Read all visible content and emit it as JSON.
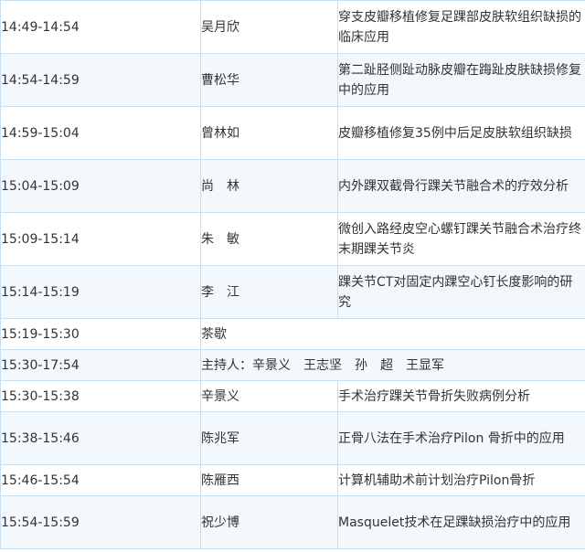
{
  "rows": [
    {
      "time": "14:49-14:54",
      "speaker": "吴月欣",
      "topic": "穿支皮瓣移植修复足踝部皮肤软组织缺损的临床应用"
    },
    {
      "time": "14:54-14:59",
      "speaker": "曹松华",
      "topic": "第二趾胫侧趾动脉皮瓣在踇趾皮肤缺损修复中的应用"
    },
    {
      "time": "14:59-15:04",
      "speaker": "曾林如",
      "topic": "皮瓣移植修复35例中后足皮肤软组织缺损"
    },
    {
      "time": "15:04-15:09",
      "speaker": "尚　林",
      "topic": "内外踝双截骨行踝关节融合术的疗效分析"
    },
    {
      "time": "15:09-15:14",
      "speaker": "朱　敏",
      "topic": "微创入路经皮空心螺钉踝关节融合术治疗终末期踝关节炎"
    },
    {
      "time": "15:14-15:19",
      "speaker": "李　江",
      "topic": "踝关节CT对固定内踝空心钉长度影响的研究"
    },
    {
      "time": "15:19-15:30",
      "speaker": "茶歇",
      "topic": ""
    },
    {
      "time": "15:30-17:54",
      "speaker": "主持人：辛景义　王志坚　孙　超　王显军",
      "topic": ""
    },
    {
      "time": "15:30-15:38",
      "speaker": "辛景义",
      "topic": "手术治疗踝关节骨折失败病例分析"
    },
    {
      "time": "15:38-15:46",
      "speaker": "陈兆军",
      "topic": "正骨八法在手术治疗Pilon 骨折中的应用"
    },
    {
      "time": "15:46-15:54",
      "speaker": "陈雁西",
      "topic": "计算机辅助术前计划治疗Pilon骨折"
    },
    {
      "time": "15:54-15:59",
      "speaker": "祝少博",
      "topic": "Masquelet技术在足踝缺损治疗中的应用"
    }
  ]
}
